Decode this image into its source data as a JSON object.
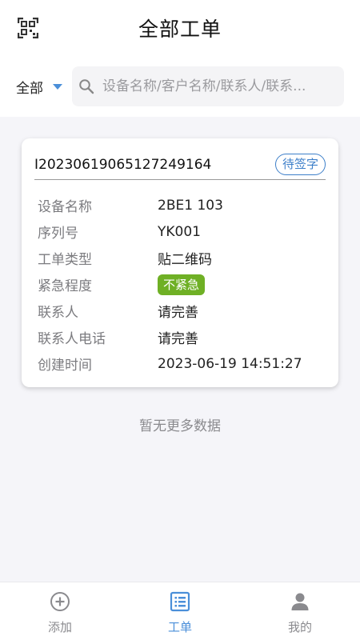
{
  "header": {
    "title": "全部工单",
    "scan_icon": "qr-scan-icon"
  },
  "filter": {
    "selected": "全部",
    "search_placeholder": "设备名称/客户名称/联系人/联系..."
  },
  "order": {
    "number": "I20230619065127249164",
    "status": "待签字",
    "fields": {
      "device_name": {
        "label": "设备名称",
        "value": "2BE1 103"
      },
      "serial_no": {
        "label": "序列号",
        "value": "YK001"
      },
      "order_type": {
        "label": "工单类型",
        "value": "贴二维码"
      },
      "urgency": {
        "label": "紧急程度",
        "value": "不紧急"
      },
      "contact": {
        "label": "联系人",
        "value": "请完善"
      },
      "contact_phone": {
        "label": "联系人电话",
        "value": "请完善"
      },
      "created_at": {
        "label": "创建时间",
        "value": "2023-06-19 14:51:27"
      }
    }
  },
  "empty_hint": "暂无更多数据",
  "tabs": [
    {
      "label": "添加",
      "icon": "add-circle-icon",
      "active": false
    },
    {
      "label": "工单",
      "icon": "list-icon",
      "active": true
    },
    {
      "label": "我的",
      "icon": "person-icon",
      "active": false
    }
  ],
  "colors": {
    "accent": "#4b8fd9",
    "status_badge": "#3d7fc9",
    "urgency_tag": "#6fb025",
    "background": "#f5f5f9"
  }
}
